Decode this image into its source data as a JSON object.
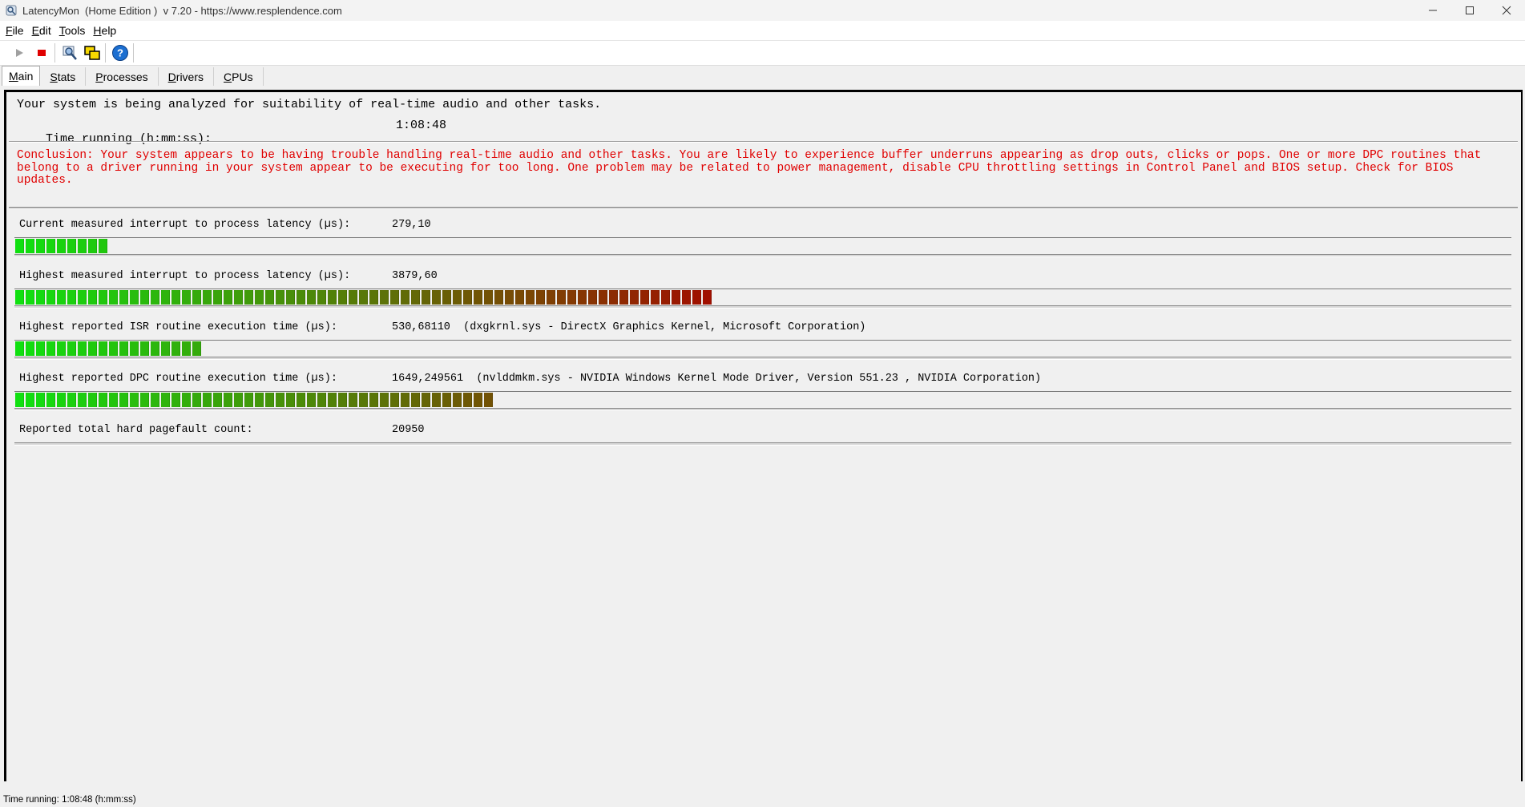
{
  "window": {
    "title": "LatencyMon  (Home Edition )  v 7.20 - https://www.resplendence.com"
  },
  "menu": {
    "items": [
      {
        "ul": "F",
        "rest": "ile"
      },
      {
        "ul": "E",
        "rest": "dit"
      },
      {
        "ul": "T",
        "rest": "ools"
      },
      {
        "ul": "H",
        "rest": "elp"
      }
    ]
  },
  "toolbar": {
    "icons": [
      "play-icon",
      "stop-icon",
      "inspect-icon",
      "copy-windows-icon",
      "help-icon"
    ],
    "colors": {
      "play": "#a0a0a0",
      "stop": "#e00000",
      "help": "#1c6fd1"
    }
  },
  "tabs": [
    {
      "ul": "M",
      "rest": "ain",
      "active": true
    },
    {
      "ul": "S",
      "rest": "tats",
      "active": false
    },
    {
      "ul": "P",
      "rest": "rocesses",
      "active": false
    },
    {
      "ul": "D",
      "rest": "rivers",
      "active": false
    },
    {
      "ul": "C",
      "rest": "PUs",
      "active": false
    }
  ],
  "main": {
    "intro": "Your system is being analyzed for suitability of real-time audio and other tasks.",
    "time_label": "Time running (h:mm:ss):",
    "time_value": "1:08:48",
    "conclusion": "Conclusion: Your system appears to be having trouble handling real-time audio and other tasks. You are likely to experience buffer underruns appearing as drop outs, clicks or pops. One or more DPC routines that belong to a driver running in your system appear to be executing for too long. One problem may be related to power management, disable CPU throttling settings in Control Panel and BIOS setup. Check for BIOS updates.",
    "conclusion_color": "#e00000",
    "metrics": [
      {
        "label": "Current measured interrupt to process latency (µs):",
        "value": "279,10",
        "segments": 9
      },
      {
        "label": "Highest measured interrupt to process latency (µs):",
        "value": "3879,60",
        "segments": 67
      },
      {
        "label": "Highest reported ISR routine execution time (µs):",
        "value": "530,68110  (dxgkrnl.sys - DirectX Graphics Kernel, Microsoft Corporation)",
        "segments": 18
      },
      {
        "label": "Highest reported DPC routine execution time (µs):",
        "value": "1649,249561  (nvlddmkm.sys - NVIDIA Windows Kernel Mode Driver, Version 551.23 , NVIDIA Corporation)",
        "segments": 46
      },
      {
        "label": "Reported total hard pagefault count:",
        "value": "20950",
        "segments": 0
      }
    ],
    "bar_colors": {
      "start": "#10e010",
      "end": "#a01000"
    }
  },
  "statusbar": {
    "text": "Time running: 1:08:48  (h:mm:ss)"
  }
}
